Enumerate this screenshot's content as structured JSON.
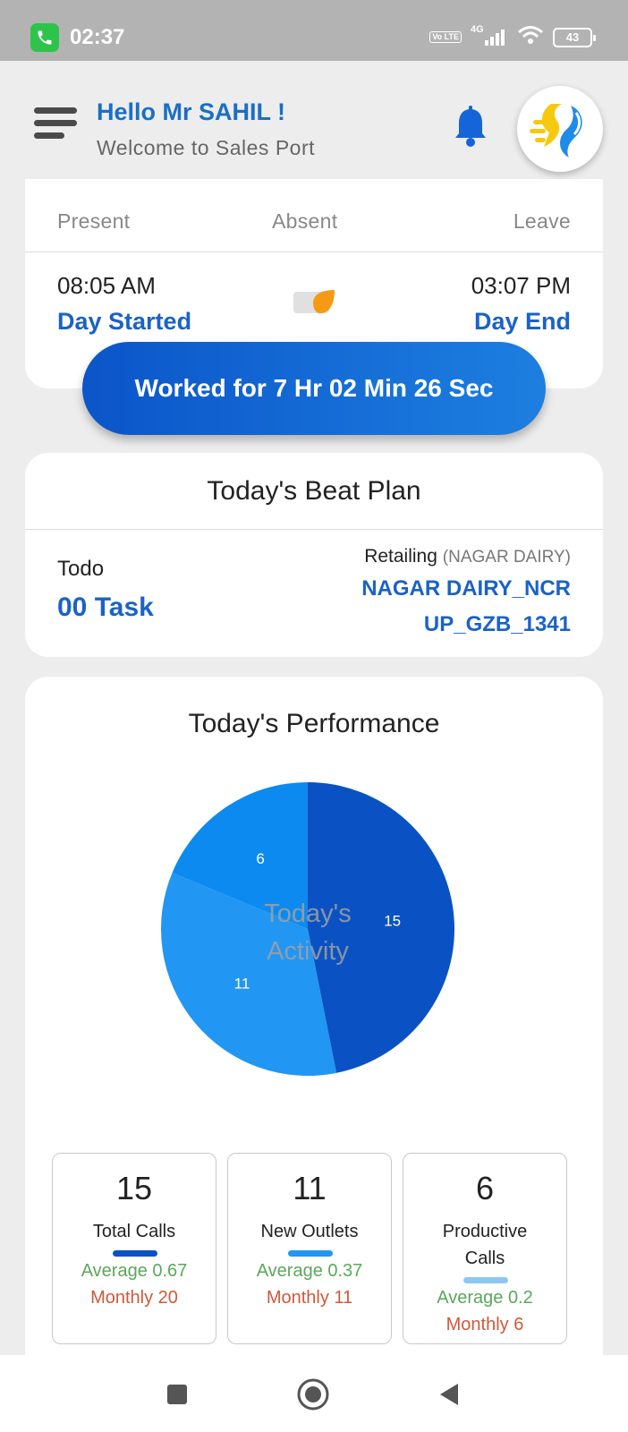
{
  "status_bar": {
    "time": "02:37",
    "network_type": "4G",
    "volte": "Vo LTE",
    "battery": "43",
    "icons": [
      "phone-call-icon",
      "volte-icon",
      "signal-icon",
      "wifi-icon",
      "battery-icon"
    ]
  },
  "header": {
    "greeting": "Hello Mr SAHIL !",
    "subtitle": "Welcome to Sales Port",
    "icons": [
      "hamburger-menu-icon",
      "bell-icon",
      "app-logo"
    ],
    "accent_color": "#1a6fc4"
  },
  "attendance": {
    "tabs": [
      "Present",
      "Absent",
      "Leave"
    ],
    "start_time": "08:05 AM",
    "start_label": "Day Started",
    "end_time": "03:07 PM",
    "end_label": "Day End",
    "worked_text": "Worked for 7 Hr 02 Min 26 Sec"
  },
  "beat_plan": {
    "title": "Today's Beat Plan",
    "todo_label": "Todo",
    "todo_value": "00 Task",
    "retail_label": "Retailing",
    "retail_sub": "(NAGAR DAIRY)",
    "retail_name": "NAGAR DAIRY_NCR",
    "retail_code": "UP_GZB_1341"
  },
  "performance": {
    "title": "Today's Performance",
    "stats": [
      {
        "value": "15",
        "label": "Total Calls",
        "average": "Average 0.67",
        "monthly": "Monthly 20",
        "color": "#0a52c4"
      },
      {
        "value": "11",
        "label": "New Outlets",
        "average": "Average 0.37",
        "monthly": "Monthly 11",
        "color": "#2196f3"
      },
      {
        "value": "6",
        "label": "Productive Calls",
        "label_line1": "Productive",
        "label_line2": "Calls",
        "average": "Average 0.2",
        "monthly": "Monthly 6",
        "color": "#8cc8f0"
      }
    ]
  },
  "chart_data": {
    "type": "pie",
    "center_label": [
      "Today's",
      "Activity"
    ],
    "categories": [
      "Total Calls",
      "New Outlets",
      "Productive Calls"
    ],
    "values": [
      15,
      11,
      6
    ],
    "colors": [
      "#0a52c4",
      "#2196f3",
      "#0d8aef"
    ]
  },
  "nav_bar": {
    "icons": [
      "recents-square-icon",
      "home-circle-icon",
      "back-triangle-icon"
    ]
  }
}
